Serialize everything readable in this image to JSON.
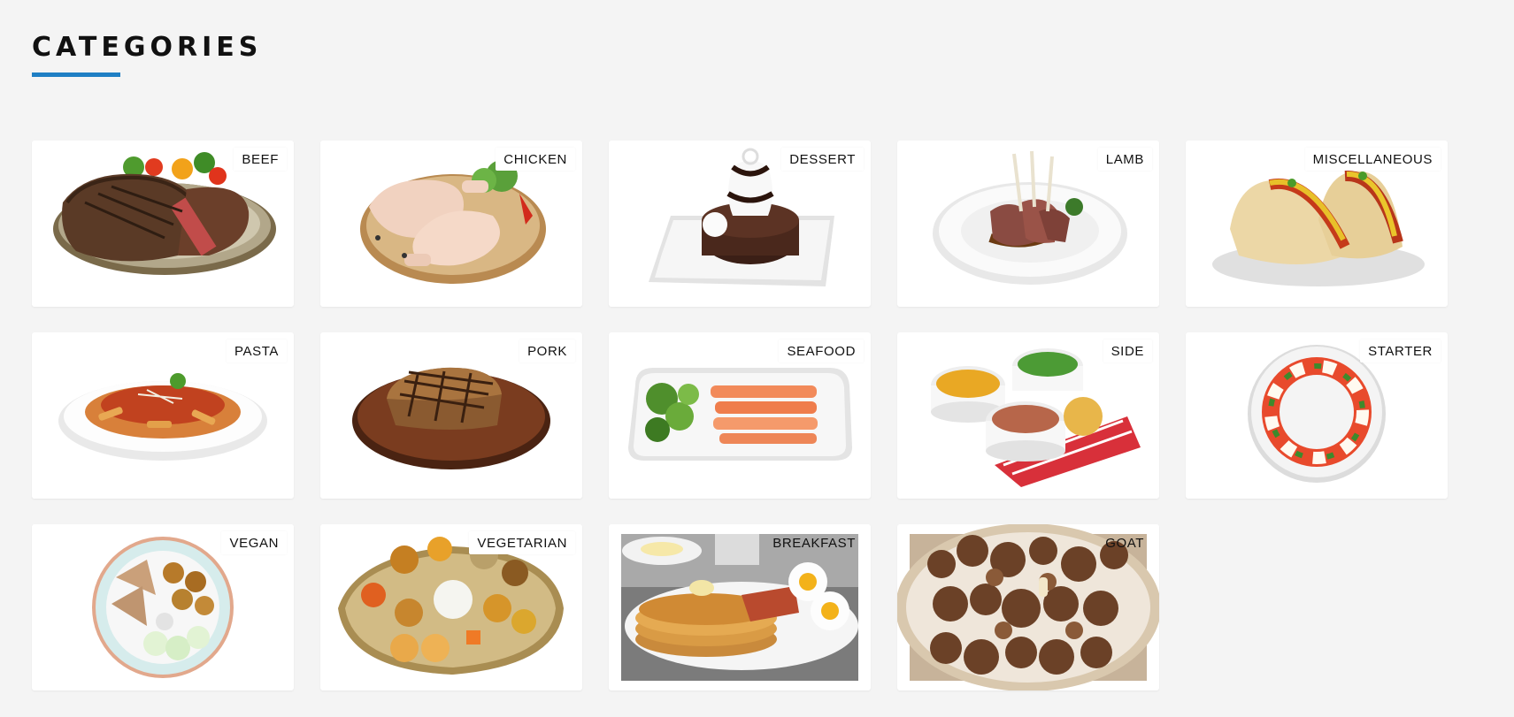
{
  "header": {
    "title": "CATEGORIES",
    "accent_color": "#1f7fc4"
  },
  "categories": [
    {
      "label": "BEEF",
      "icon": "beef-steak-image"
    },
    {
      "label": "CHICKEN",
      "icon": "chicken-legs-image"
    },
    {
      "label": "DESSERT",
      "icon": "chocolate-cake-image"
    },
    {
      "label": "LAMB",
      "icon": "lamb-chops-image"
    },
    {
      "label": "MISCELLANEOUS",
      "icon": "tacos-image"
    },
    {
      "label": "PASTA",
      "icon": "penne-pasta-image"
    },
    {
      "label": "PORK",
      "icon": "pork-chop-image"
    },
    {
      "label": "SEAFOOD",
      "icon": "salmon-plate-image"
    },
    {
      "label": "SIDE",
      "icon": "side-dishes-image"
    },
    {
      "label": "STARTER",
      "icon": "caprese-salad-image"
    },
    {
      "label": "VEGAN",
      "icon": "vegan-bowl-image"
    },
    {
      "label": "VEGETARIAN",
      "icon": "thali-platter-image"
    },
    {
      "label": "BREAKFAST",
      "icon": "pancakes-image"
    },
    {
      "label": "GOAT",
      "icon": "goat-meat-image"
    }
  ]
}
